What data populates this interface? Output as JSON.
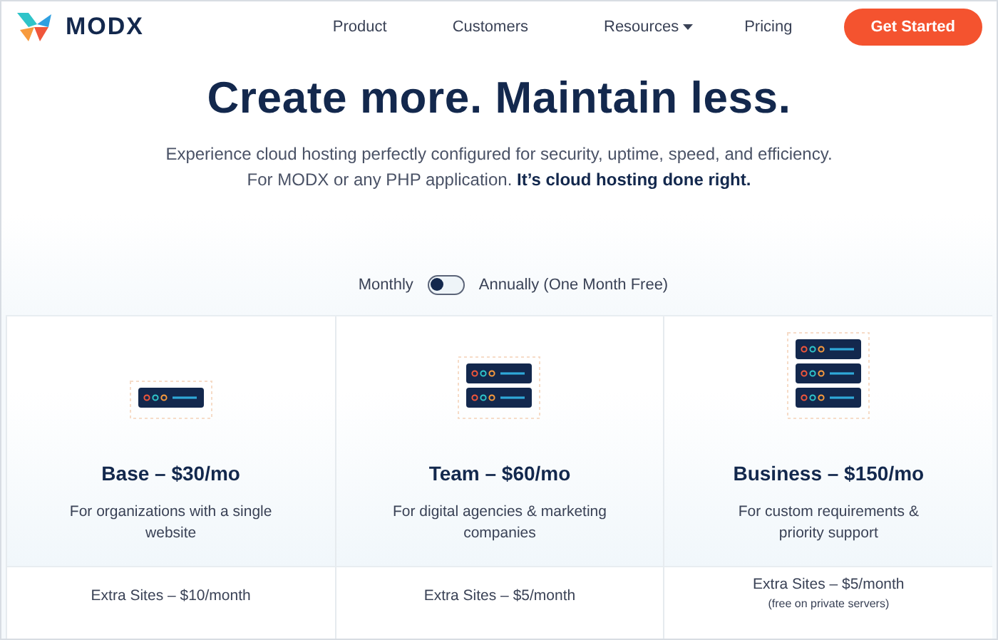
{
  "brand": {
    "name": "MODX"
  },
  "nav": [
    {
      "label": "Product",
      "has_menu": false
    },
    {
      "label": "Customers",
      "has_menu": false
    },
    {
      "label": "Resources",
      "has_menu": true
    },
    {
      "label": "Pricing",
      "has_menu": false
    }
  ],
  "cta": "Get Started",
  "hero": {
    "title": "Create more. Maintain less.",
    "lines": [
      "Experience cloud hosting perfectly configured for security, uptime, speed, and efficiency.",
      "For MODX or any PHP application. **It’s cloud hosting done right.**"
    ]
  },
  "billing": {
    "left": "Monthly",
    "right": "Annually (One Month Free)",
    "annually": false
  },
  "plans": [
    {
      "kind": "one-server",
      "name": "Base – $30/mo",
      "description": "For organizations with a single website",
      "extra": "Extra Sites – $10/month"
    },
    {
      "kind": "two-server",
      "name": "Team – $60/mo",
      "description": "For digital agencies & marketing companies",
      "extra": "Extra Sites – $5/month"
    },
    {
      "kind": "three-server",
      "name": "Business – $150/mo",
      "description": "For custom requirements & priority support",
      "extra": "Extra Sites – $5/month",
      "note": "(free on private servers)"
    }
  ]
}
